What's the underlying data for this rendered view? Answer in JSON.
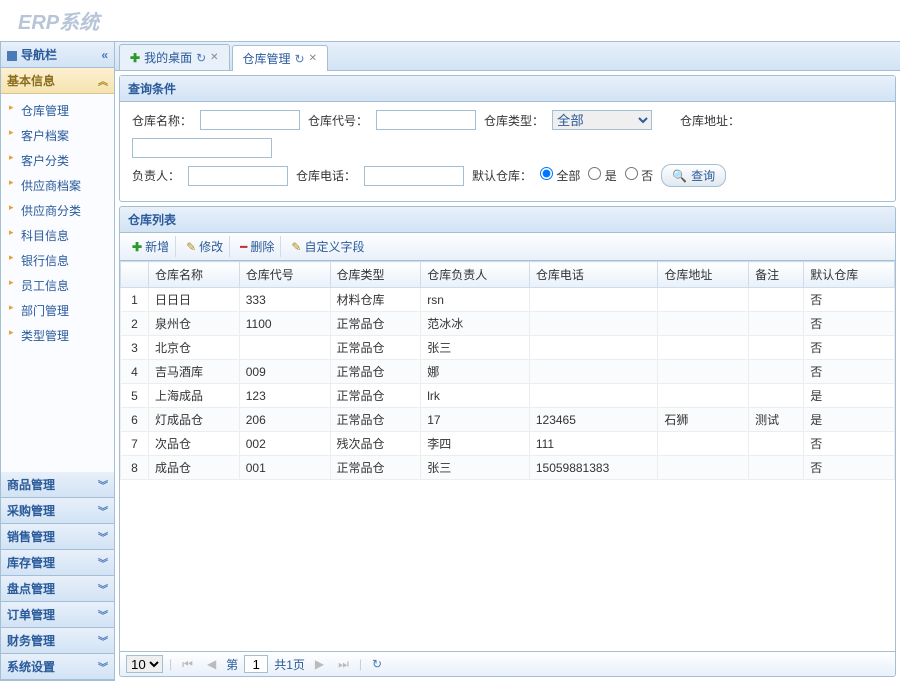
{
  "app": {
    "title": "ERP系统"
  },
  "sidebar": {
    "header": "导航栏",
    "sections": [
      {
        "label": "基本信息",
        "expanded": true,
        "items": [
          {
            "label": "仓库管理"
          },
          {
            "label": "客户档案"
          },
          {
            "label": "客户分类"
          },
          {
            "label": "供应商档案"
          },
          {
            "label": "供应商分类"
          },
          {
            "label": "科目信息"
          },
          {
            "label": "银行信息"
          },
          {
            "label": "员工信息"
          },
          {
            "label": "部门管理"
          },
          {
            "label": "类型管理"
          }
        ]
      },
      {
        "label": "商品管理",
        "expanded": false
      },
      {
        "label": "采购管理",
        "expanded": false
      },
      {
        "label": "销售管理",
        "expanded": false
      },
      {
        "label": "库存管理",
        "expanded": false
      },
      {
        "label": "盘点管理",
        "expanded": false
      },
      {
        "label": "订单管理",
        "expanded": false
      },
      {
        "label": "财务管理",
        "expanded": false
      },
      {
        "label": "系统设置",
        "expanded": false
      }
    ]
  },
  "tabs": [
    {
      "label": "我的桌面",
      "active": false,
      "closable": true,
      "icon": "plus"
    },
    {
      "label": "仓库管理",
      "active": true,
      "closable": true,
      "icon": ""
    }
  ],
  "search": {
    "panel_title": "查询条件",
    "fields": {
      "name_label": "仓库名称：",
      "code_label": "仓库代号：",
      "type_label": "仓库类型：",
      "addr_label": "仓库地址：",
      "owner_label": "负责人：",
      "phone_label": "仓库电话：",
      "default_label": "默认仓库：",
      "type_value": "全部",
      "radio_all": "全部",
      "radio_yes": "是",
      "radio_no": "否",
      "search_btn": "查询"
    }
  },
  "list": {
    "panel_title": "仓库列表",
    "toolbar": {
      "add": "新增",
      "edit": "修改",
      "del": "删除",
      "custom": "自定义字段"
    },
    "columns": [
      "",
      "仓库名称",
      "仓库代号",
      "仓库类型",
      "仓库负责人",
      "仓库电话",
      "仓库地址",
      "备注",
      "默认仓库"
    ],
    "rows": [
      {
        "n": 1,
        "name": "日日日",
        "code": "333",
        "type": "材料仓库",
        "owner": "rsn",
        "phone": "",
        "addr": "",
        "remark": "",
        "def": "否"
      },
      {
        "n": 2,
        "name": "泉州仓",
        "code": "1100",
        "type": "正常品仓",
        "owner": "范冰冰",
        "phone": "",
        "addr": "",
        "remark": "",
        "def": "否"
      },
      {
        "n": 3,
        "name": "北京仓",
        "code": "",
        "type": "正常品仓",
        "owner": "张三",
        "phone": "",
        "addr": "",
        "remark": "",
        "def": "否"
      },
      {
        "n": 4,
        "name": "吉马酒库",
        "code": "009",
        "type": "正常品仓",
        "owner": "娜",
        "phone": "",
        "addr": "",
        "remark": "",
        "def": "否"
      },
      {
        "n": 5,
        "name": "上海成品",
        "code": "123",
        "type": "正常品仓",
        "owner": "lrk",
        "phone": "",
        "addr": "",
        "remark": "",
        "def": "是"
      },
      {
        "n": 6,
        "name": "灯成品仓",
        "code": "206",
        "type": "正常品仓",
        "owner": "17",
        "phone": "123465",
        "addr": "石狮",
        "remark": "测试",
        "def": "是"
      },
      {
        "n": 7,
        "name": "次品仓",
        "code": "002",
        "type": "残次品仓",
        "owner": "李四",
        "phone": "111",
        "addr": "",
        "remark": "",
        "def": "否"
      },
      {
        "n": 8,
        "name": "成品仓",
        "code": "001",
        "type": "正常品仓",
        "owner": "张三",
        "phone": "15059881383",
        "addr": "",
        "remark": "",
        "def": "否"
      }
    ]
  },
  "pager": {
    "page_size": "10",
    "page_label_prefix": "第",
    "page_value": "1",
    "total_label": "共1页"
  }
}
